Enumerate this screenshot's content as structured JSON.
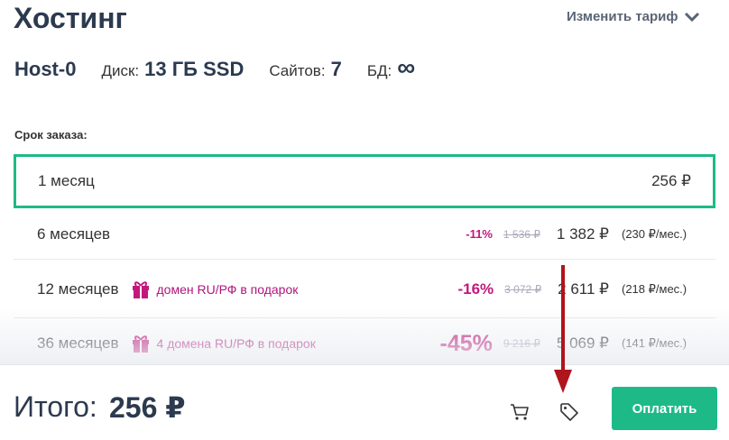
{
  "header": {
    "title": "Хостинг",
    "change_tariff": "Изменить тариф"
  },
  "plan": {
    "name": "Host-0",
    "disk_label": "Диск:",
    "disk_value": "13 ГБ SSD",
    "sites_label": "Сайтов:",
    "sites_value": "7",
    "db_label": "БД:",
    "db_value": "∞"
  },
  "period_label": "Срок заказа:",
  "options": [
    {
      "name": "1 месяц",
      "price": "256 ₽",
      "selected": true
    },
    {
      "name": "6 месяцев",
      "discount": "-11%",
      "old_price": "1 536 ₽",
      "price": "1 382 ₽",
      "per_month": "(230 ₽/мес.)"
    },
    {
      "name": "12 месяцев",
      "gift": "домен RU/РФ в подарок",
      "discount": "-16%",
      "old_price": "3 072 ₽",
      "price": "2 611 ₽",
      "per_month": "(218 ₽/мес.)"
    },
    {
      "name": "36 месяцев",
      "gift": "4 домена RU/РФ в подарок",
      "discount": "-45%",
      "old_price": "9 216 ₽",
      "price": "5 069 ₽",
      "per_month": "(141 ₽/мес.)"
    }
  ],
  "footer": {
    "total_label": "Итого:",
    "total_value": "256 ₽",
    "pay_label": "Оплатить"
  },
  "colors": {
    "accent_green": "#1dba87",
    "discount_magenta": "#c2187d",
    "annotation_arrow": "#b0141c"
  },
  "icons": [
    "chevron-down-icon",
    "gift-icon",
    "cart-icon",
    "tag-icon"
  ]
}
